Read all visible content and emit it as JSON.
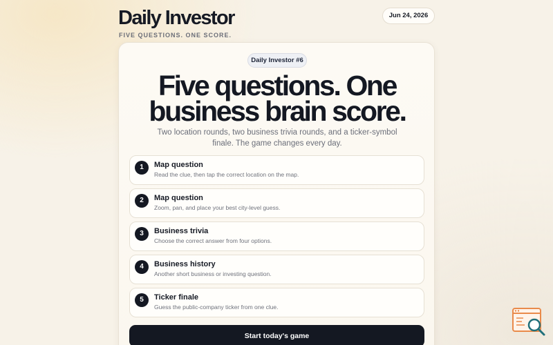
{
  "header": {
    "title": "Daily Investor",
    "tagline": "FIVE QUESTIONS. ONE SCORE.",
    "date": "Jun 24, 2026"
  },
  "card": {
    "badge": "Daily Investor #6",
    "headline_line1": "Five questions. One",
    "headline_line2": "business brain score.",
    "subtitle": "Two location rounds, two business trivia rounds, and a ticker-symbol finale. The game changes every day.",
    "steps": [
      {
        "number": "1",
        "title": "Map question",
        "description": "Read the clue, then tap the correct location on the map."
      },
      {
        "number": "2",
        "title": "Map question",
        "description": "Zoom, pan, and place your best city-level guess."
      },
      {
        "number": "3",
        "title": "Business trivia",
        "description": "Choose the correct answer from four options."
      },
      {
        "number": "4",
        "title": "Business history",
        "description": "Another short business or investing question."
      },
      {
        "number": "5",
        "title": "Ticker finale",
        "description": "Guess the public-company ticker from one clue."
      }
    ],
    "start_button": "Start today's game"
  },
  "colors": {
    "background": "#f7f2e8",
    "card": "#fdfaf4",
    "primary_dark": "#141822",
    "badge_bg": "#eef0f5",
    "logo_orange": "#e98a4a",
    "logo_teal": "#1f6f7a"
  },
  "icons": {
    "corner_logo": "browser-magnifier-icon"
  }
}
